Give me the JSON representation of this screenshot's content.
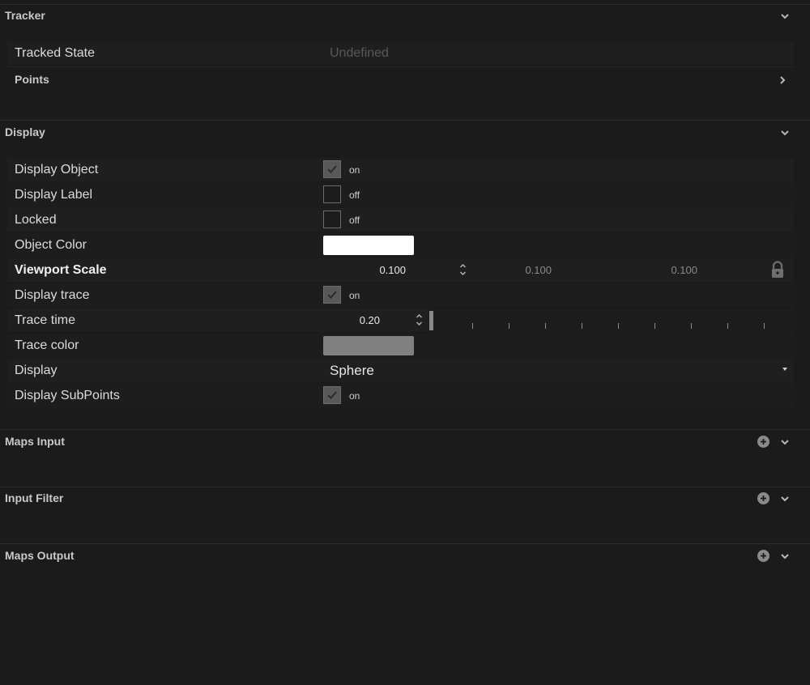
{
  "sections": {
    "tracker": {
      "title": "Tracker",
      "tracked_state": {
        "label": "Tracked State",
        "value": "Undefined"
      },
      "points": {
        "label": "Points"
      }
    },
    "display": {
      "title": "Display",
      "display_object": {
        "label": "Display Object",
        "checked": true,
        "state_text": "on"
      },
      "display_label": {
        "label": "Display Label",
        "checked": false,
        "state_text": "off"
      },
      "locked": {
        "label": "Locked",
        "checked": false,
        "state_text": "off"
      },
      "object_color": {
        "label": "Object Color",
        "color": "#ffffff"
      },
      "viewport_scale": {
        "label": "Viewport Scale",
        "x": "0.100",
        "y": "0.100",
        "z": "0.100",
        "icon": "lock-icon"
      },
      "display_trace": {
        "label": "Display trace",
        "checked": true,
        "state_text": "on"
      },
      "trace_time": {
        "label": "Trace time",
        "value": "0.20",
        "slider_fraction": 0.0
      },
      "trace_color": {
        "label": "Trace color",
        "color": "#808080"
      },
      "display_mode": {
        "label": "Display",
        "value": "Sphere"
      },
      "display_subpoints": {
        "label": "Display SubPoints",
        "checked": true,
        "state_text": "on"
      }
    },
    "maps_input": {
      "title": "Maps Input"
    },
    "input_filter": {
      "title": "Input Filter"
    },
    "maps_output": {
      "title": "Maps Output"
    }
  },
  "colors": {
    "background": "#1b1b1b",
    "row": "#1f1f1f",
    "checkbox_checked": "#585858",
    "muted_text": "#585858"
  }
}
